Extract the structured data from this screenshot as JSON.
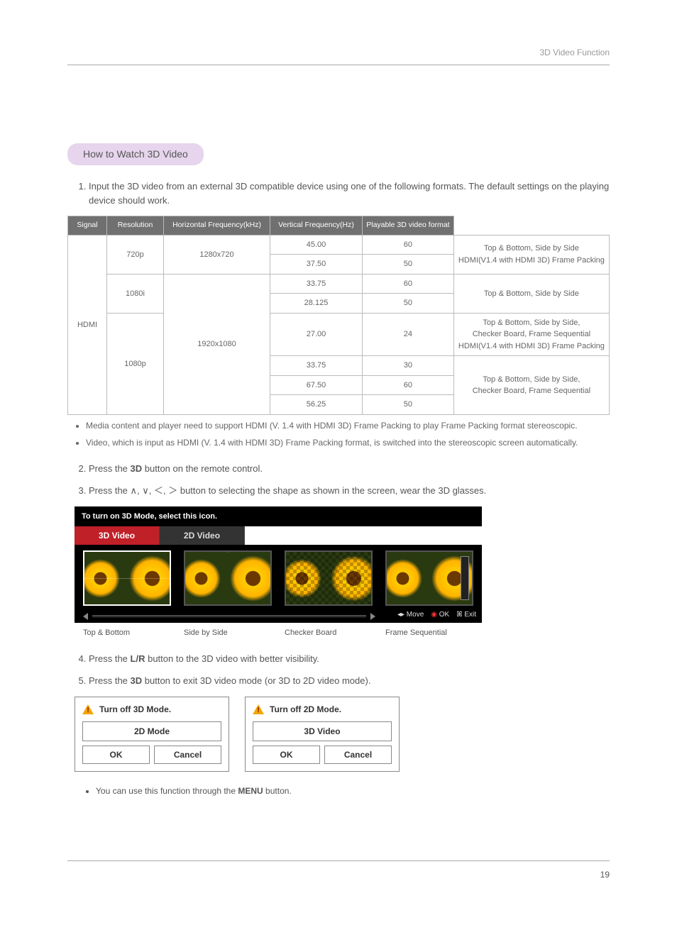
{
  "header": {
    "title": "3D Video Function"
  },
  "section": {
    "pill": "How to Watch 3D Video"
  },
  "steps": {
    "s1": "Input the 3D video from an external 3D compatible device using one of the following formats. The default settings on the playing device should work.",
    "s2_pre": "Press the ",
    "s2_bold": "3D",
    "s2_post": " button on the remote control.",
    "s3_pre": "Press the ",
    "s3_sym": "∧, ∨, ＜, ＞",
    "s3_post": " button to selecting the shape as shown in the screen, wear the 3D glasses.",
    "s4_pre": "Press the ",
    "s4_bold": "L/R ",
    "s4_post": " button to the 3D video with better visibility.",
    "s5_pre": "Press the ",
    "s5_bold": "3D ",
    "s5_post": " button to exit 3D video mode (or 3D to 2D video mode)."
  },
  "table": {
    "headers": {
      "signal": "Signal",
      "resolution": "Resolution",
      "hfreq": "Horizontal Frequency(kHz)",
      "vfreq": "Vertical Frequency(Hz)",
      "format": "Playable 3D video format"
    },
    "sideLabel": "HDMI",
    "rows": {
      "r1": {
        "signal": "720p",
        "res": "1280x720",
        "h": "45.00",
        "v": "60"
      },
      "r2": {
        "h": "37.50",
        "v": "50"
      },
      "r3": {
        "signal": "1080i",
        "res": "1920x1080",
        "h": "33.75",
        "v": "60"
      },
      "r4": {
        "h": "28.125",
        "v": "50"
      },
      "r5": {
        "signal": "1080p",
        "h": "27.00",
        "v": "24"
      },
      "r6": {
        "h": "33.75",
        "v": "30"
      },
      "r7": {
        "h": "67.50",
        "v": "60"
      },
      "r8": {
        "h": "56.25",
        "v": "50"
      }
    },
    "formats": {
      "f720_a": "Top & Bottom, Side by Side",
      "f720_b": "HDMI(V1.4 with HDMI 3D) Frame Packing",
      "f1080i": "Top & Bottom, Side by Side",
      "f1080p_24a": "Top & Bottom, Side by Side,",
      "f1080p_24b": "Checker Board, Frame Sequential",
      "f1080p_24c": "HDMI(V1.4 with HDMI 3D) Frame Packing",
      "f1080p_rest_a": "Top & Bottom, Side by Side,",
      "f1080p_rest_b": "Checker Board, Frame Sequential"
    }
  },
  "bullets_after_table": {
    "b1": "Media content and player need to support HDMI (V. 1.4 with HDMI 3D) Frame Packing to play Frame Packing format stereoscopic.",
    "b2": "Video, which is input as HDMI (V. 1.4 with HDMI 3D) Frame Packing format, is switched into the stereoscopic screen automatically."
  },
  "osd": {
    "hint": "To turn on 3D Mode, select this icon.",
    "tab_3d": "3D Video",
    "tab_2d": "2D Video",
    "labels": {
      "tb": "Top & Bottom",
      "sbs": "Side by Side",
      "chk": "Checker Board",
      "seq": "Frame Sequential"
    },
    "footer": {
      "move": "Move",
      "ok": "OK",
      "exit": "Exit"
    }
  },
  "dialogs": {
    "d1": {
      "title": "Turn off 3D Mode.",
      "mode": "2D Mode",
      "ok": "OK",
      "cancel": "Cancel"
    },
    "d2": {
      "title": "Turn off 2D Mode.",
      "mode": "3D Video",
      "ok": "OK",
      "cancel": "Cancel"
    }
  },
  "final_bullet_pre": "You can use this function through the ",
  "final_bullet_bold": "MENU",
  "final_bullet_post": " button.",
  "page_number": "19"
}
